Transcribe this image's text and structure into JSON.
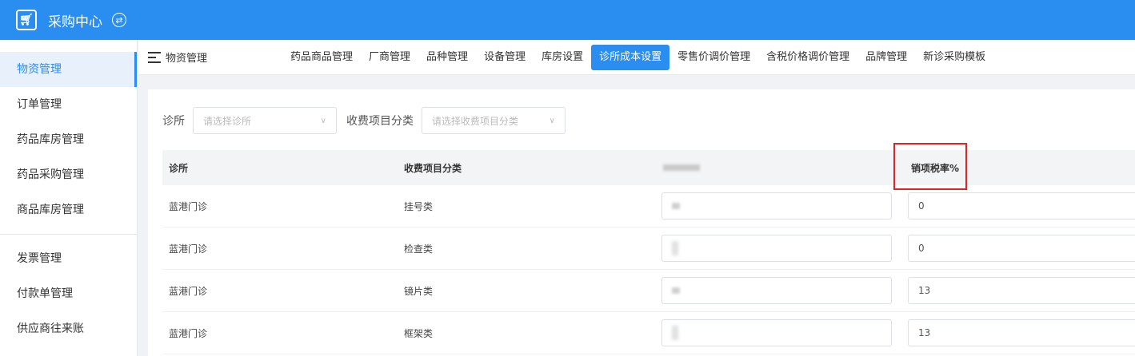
{
  "app": {
    "title": "采购中心",
    "logo_icon": "cart-icon"
  },
  "sidebar": {
    "items": [
      {
        "label": "物资管理",
        "active": true
      },
      {
        "label": "订单管理"
      },
      {
        "label": "药品库房管理"
      },
      {
        "label": "药品采购管理"
      },
      {
        "label": "商品库房管理"
      },
      {
        "label": "发票管理"
      },
      {
        "label": "付款单管理"
      },
      {
        "label": "供应商往来账"
      }
    ]
  },
  "tabbar": {
    "section_title": "物资管理",
    "tabs": [
      {
        "label": "药品商品管理"
      },
      {
        "label": "厂商管理"
      },
      {
        "label": "品种管理"
      },
      {
        "label": "设备管理"
      },
      {
        "label": "库房设置"
      },
      {
        "label": "诊所成本设置",
        "active": true
      },
      {
        "label": "零售价调价管理"
      },
      {
        "label": "含税价格调价管理"
      },
      {
        "label": "品牌管理"
      },
      {
        "label": "新诊采购模板"
      }
    ]
  },
  "filters": {
    "clinic_label": "诊所",
    "clinic_placeholder": "请选择诊所",
    "category_label": "收费项目分类",
    "category_placeholder": "请选择收费项目分类"
  },
  "table": {
    "headers": {
      "clinic": "诊所",
      "category": "收费项目分类",
      "rate": "销项税率%"
    },
    "rows": [
      {
        "clinic": "蓝港门诊",
        "category": "挂号类",
        "rate": "0"
      },
      {
        "clinic": "蓝港门诊",
        "category": "检查类",
        "rate": "0"
      },
      {
        "clinic": "蓝港门诊",
        "category": "镜片类",
        "rate": "13"
      },
      {
        "clinic": "蓝港门诊",
        "category": "框架类",
        "rate": "13"
      }
    ]
  },
  "colors": {
    "primary": "#2a8df0",
    "highlight": "#e02424"
  }
}
